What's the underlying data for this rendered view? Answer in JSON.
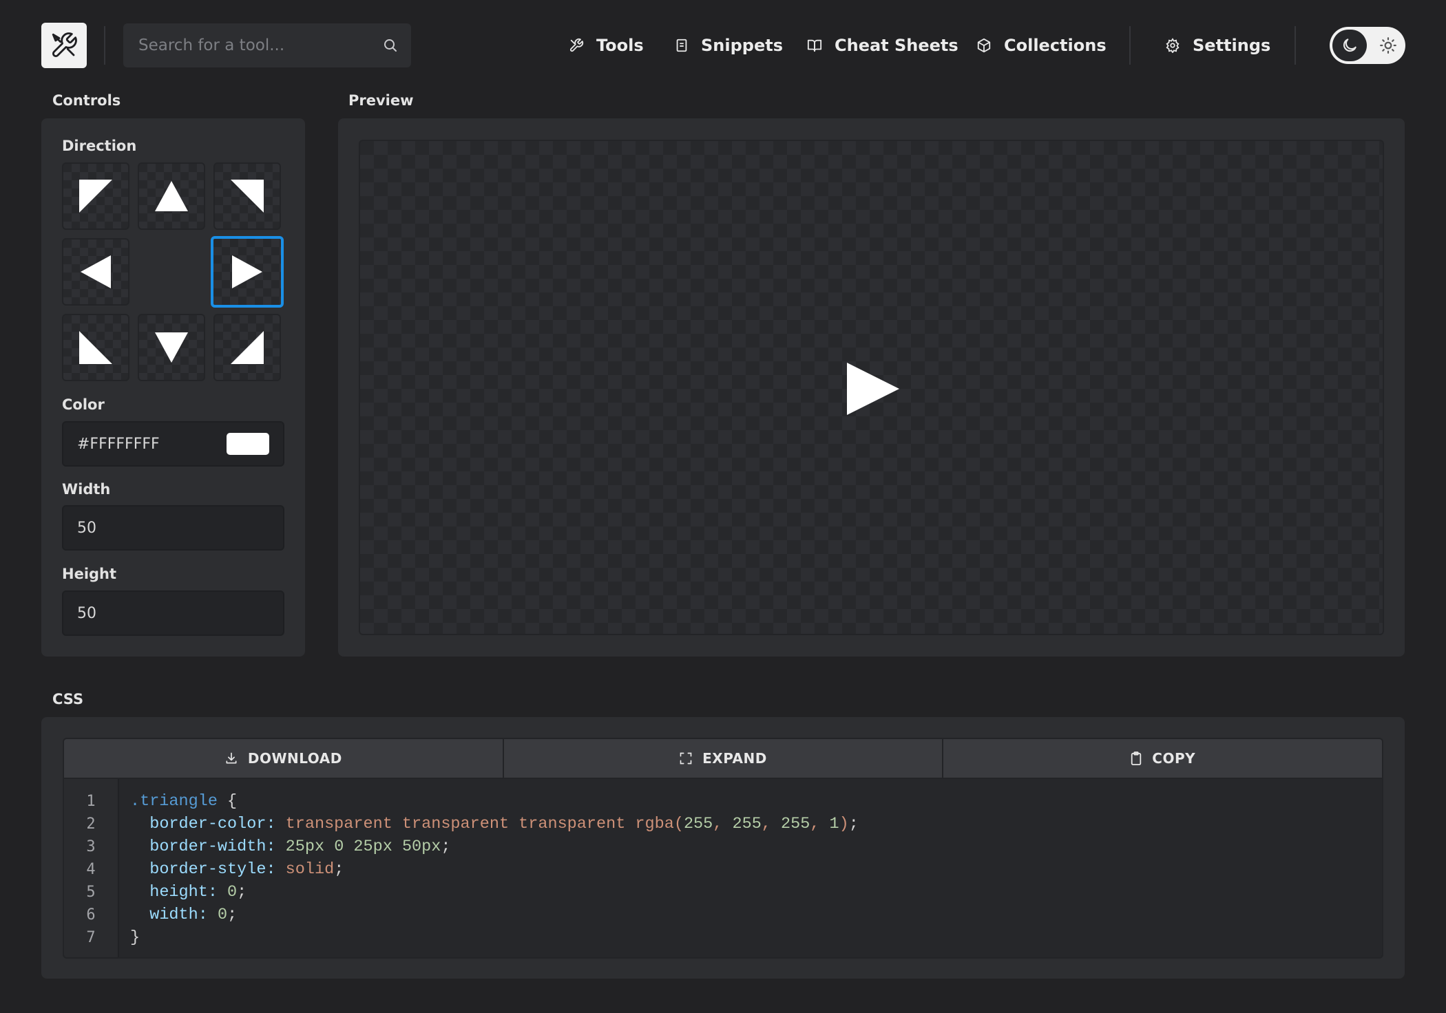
{
  "header": {
    "search_placeholder": "Search for a tool...",
    "nav": [
      {
        "label": "Tools",
        "icon": "tools-icon"
      },
      {
        "label": "Snippets",
        "icon": "snippet-icon"
      },
      {
        "label": "Cheat Sheets",
        "icon": "book-icon"
      },
      {
        "label": "Collections",
        "icon": "box-icon"
      },
      {
        "label": "Settings",
        "icon": "gear-icon"
      }
    ],
    "theme": {
      "active": "dark",
      "icons": [
        "moon-icon",
        "sun-icon"
      ]
    }
  },
  "controls": {
    "title": "Controls",
    "direction_label": "Direction",
    "directions": [
      "top-left",
      "top",
      "top-right",
      "left",
      "right",
      "bottom-left",
      "bottom",
      "bottom-right"
    ],
    "selected_direction": "right",
    "color_label": "Color",
    "color_value": "#FFFFFFFF",
    "width_label": "Width",
    "width_value": "50",
    "height_label": "Height",
    "height_value": "50"
  },
  "preview": {
    "title": "Preview"
  },
  "css": {
    "title": "CSS",
    "buttons": {
      "download": "DOWNLOAD",
      "expand": "EXPAND",
      "copy": "COPY"
    },
    "line_numbers": [
      "1",
      "2",
      "3",
      "4",
      "5",
      "6",
      "7"
    ],
    "code": [
      ".triangle {",
      "  border-color: transparent transparent transparent rgba(255, 255, 255, 1);",
      "  border-width: 25px 0 25px 50px;",
      "  border-style: solid;",
      "  height: 0;",
      "  width: 0;",
      "}"
    ]
  },
  "colors": {
    "background": "#222224",
    "card": "#2d2e31",
    "accent": "#1a8fe6",
    "triangle": "#ffffff"
  }
}
